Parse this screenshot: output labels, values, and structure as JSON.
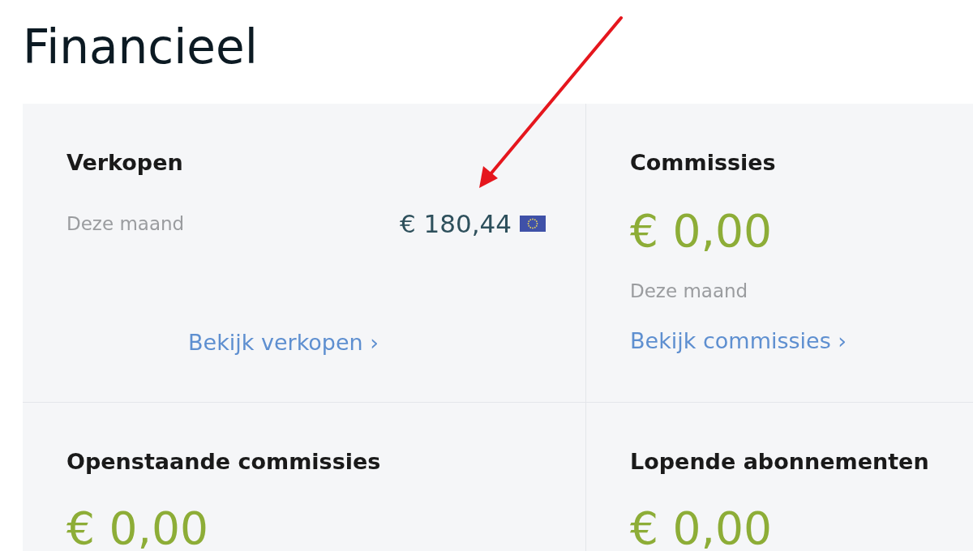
{
  "page": {
    "title": "Financieel"
  },
  "cards": [
    {
      "kind": "inline",
      "title": "Verkopen",
      "period": "Deze maand",
      "amount": "€ 180,44",
      "link": "Bekijk verkopen ›"
    },
    {
      "kind": "stacked",
      "title": "Commissies",
      "amount": "€ 0,00",
      "period": "Deze maand",
      "link": "Bekijk commissies ›"
    },
    {
      "kind": "stacked",
      "title": "Openstaande commissies",
      "amount": "€ 0,00"
    },
    {
      "kind": "stacked",
      "title": "Lopende abonnementen",
      "amount": "€ 0,00"
    }
  ]
}
